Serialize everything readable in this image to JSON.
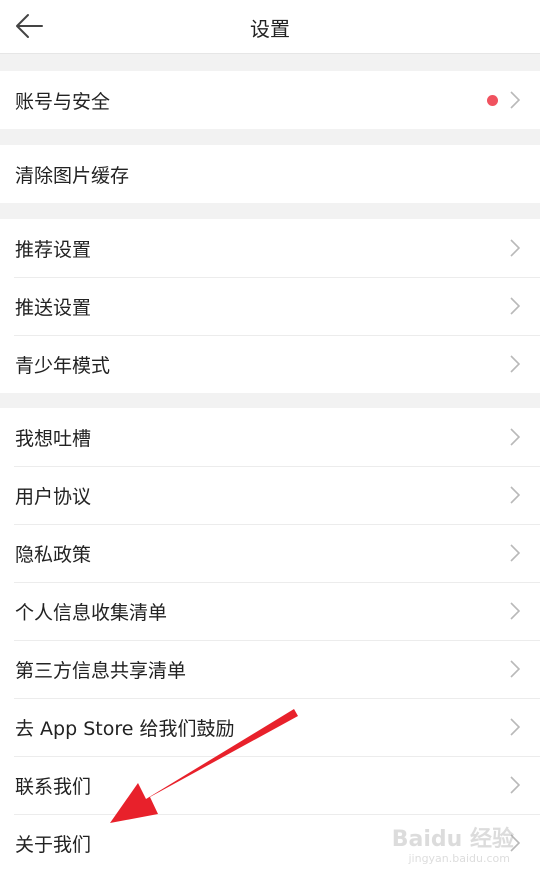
{
  "header": {
    "title": "设置"
  },
  "sections": [
    {
      "items": [
        {
          "label": "账号与安全",
          "has_badge": true
        }
      ]
    },
    {
      "items": [
        {
          "label": "清除图片缓存",
          "chevron": false
        }
      ]
    },
    {
      "items": [
        {
          "label": "推荐设置"
        },
        {
          "label": "推送设置"
        },
        {
          "label": "青少年模式"
        }
      ]
    },
    {
      "items": [
        {
          "label": "我想吐槽"
        },
        {
          "label": "用户协议"
        },
        {
          "label": "隐私政策"
        },
        {
          "label": "个人信息收集清单"
        },
        {
          "label": "第三方信息共享清单"
        },
        {
          "label": "去 App Store 给我们鼓励"
        },
        {
          "label": "联系我们"
        },
        {
          "label": "关于我们"
        }
      ]
    }
  ],
  "colors": {
    "badge": "#f0525f",
    "annotation_arrow": "#e8212b",
    "chevron": "#b9b9b9"
  },
  "icons": {
    "back": "back-arrow-icon",
    "chevron": "chevron-right-icon",
    "badge": "red-dot-badge"
  },
  "watermark": {
    "text": "Baidu 经验",
    "url": "jingyan.baidu.com"
  }
}
